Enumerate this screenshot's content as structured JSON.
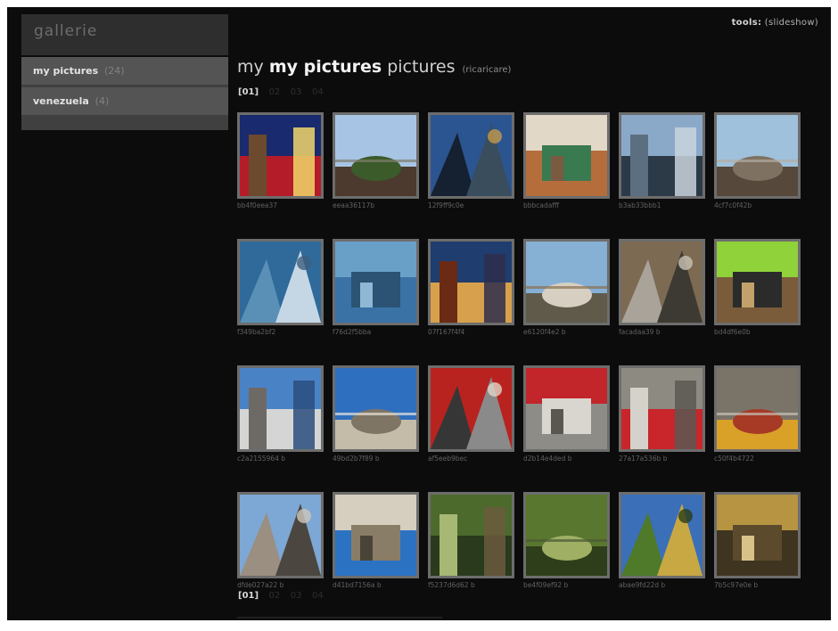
{
  "sidebar": {
    "brand": "gallerie",
    "galleries": [
      {
        "label": "my pictures",
        "count": "(24)"
      },
      {
        "label": "venezuela",
        "count": "(4)"
      }
    ]
  },
  "tools": {
    "label": "tools:",
    "slideshow": "(slideshow)"
  },
  "header": {
    "prefix": "my",
    "strong": "my pictures",
    "suffix": "pictures",
    "reload": "(ricaricare)"
  },
  "pager": {
    "current": "[01]",
    "pages": [
      "02",
      "03",
      "04"
    ]
  },
  "photos": [
    {
      "caption": "bb4f0eea37",
      "palette": [
        "#1a2a6e",
        "#b51c2a",
        "#6b4a2e",
        "#f1d66a"
      ]
    },
    {
      "caption": "eeaa36117b",
      "palette": [
        "#a8c4e4",
        "#4b3a2d",
        "#3c5b2a",
        "#7d7d6c"
      ]
    },
    {
      "caption": "12f9ff9c0e",
      "palette": [
        "#2b5590",
        "#152030",
        "#3a4d5c",
        "#c39a4c"
      ]
    },
    {
      "caption": "bbbcadafff",
      "palette": [
        "#b56d3c",
        "#e2d8c8",
        "#3a7a50",
        "#7a5a40"
      ]
    },
    {
      "caption": "b3ab33bbb1",
      "palette": [
        "#8aa9c9",
        "#2c3a48",
        "#5c6f80",
        "#c9d3dd"
      ]
    },
    {
      "caption": "4cf7c0f42b",
      "palette": [
        "#9fc1db",
        "#56483b",
        "#7f7161",
        "#b4aea4"
      ]
    },
    {
      "caption": "f349ba2bf2",
      "palette": [
        "#2f6a9a",
        "#5b90b6",
        "#c5d7e5",
        "#3d5e7d"
      ]
    },
    {
      "caption": "f76d2f5bba",
      "palette": [
        "#3a72a6",
        "#68a0c8",
        "#2c5274",
        "#8fb8d4"
      ]
    },
    {
      "caption": "07f167f4f4",
      "palette": [
        "#1f3d6e",
        "#d7a04c",
        "#6b2a14",
        "#2e2e4e"
      ]
    },
    {
      "caption": "e6120f4e2 b",
      "palette": [
        "#86b0d4",
        "#5f5a4a",
        "#d6cfc2",
        "#8a7050"
      ]
    },
    {
      "caption": "facadaa39 b",
      "palette": [
        "#7c6a52",
        "#a9a39a",
        "#3d3a33",
        "#c9c2b4"
      ]
    },
    {
      "caption": "bd4df6e0b",
      "palette": [
        "#7a5c3a",
        "#8fd23a",
        "#2b2b2b",
        "#c2a26a"
      ]
    },
    {
      "caption": "c2a2155964 b",
      "palette": [
        "#4a82c6",
        "#d5d5d5",
        "#6d6a65",
        "#2c4e7e"
      ]
    },
    {
      "caption": "49bd2b7f89 b",
      "palette": [
        "#2f6fc0",
        "#c4bba8",
        "#7f7564",
        "#e8e4dc"
      ]
    },
    {
      "caption": "af5eeb9bec",
      "palette": [
        "#b8231f",
        "#363636",
        "#8a8a8a",
        "#e0d6c8"
      ]
    },
    {
      "caption": "d2b14e4ded b",
      "palette": [
        "#8e8c86",
        "#c2252a",
        "#d8d6cf",
        "#5a5650"
      ]
    },
    {
      "caption": "27a17a536b b",
      "palette": [
        "#8d8a82",
        "#c8262a",
        "#d4d2cb",
        "#5c5852"
      ]
    },
    {
      "caption": "c50f4b4722",
      "palette": [
        "#7a7468",
        "#d9a127",
        "#a63a25",
        "#c7c2b8"
      ]
    },
    {
      "caption": "dfde027a22 b",
      "palette": [
        "#7da7d4",
        "#9a8f80",
        "#4b4640",
        "#cfc7bb"
      ]
    },
    {
      "caption": "d41bd7156a b",
      "palette": [
        "#2c72c2",
        "#d6cfc0",
        "#8a7d68",
        "#4a4438"
      ]
    },
    {
      "caption": "f5237d6d62 b",
      "palette": [
        "#4c6a2c",
        "#2a3a1c",
        "#a7b875",
        "#6b5a3e"
      ]
    },
    {
      "caption": "be4f09ef92 b",
      "palette": [
        "#59772e",
        "#2e3e1a",
        "#9fb064",
        "#4b5a36"
      ]
    },
    {
      "caption": "abae9fd22d b",
      "palette": [
        "#3b6fb8",
        "#4e7a2a",
        "#c8a843",
        "#2c3d18"
      ]
    },
    {
      "caption": "7b5c97e0e b",
      "palette": [
        "#3e3420",
        "#b69442",
        "#5c4a2c",
        "#d8c28a"
      ]
    }
  ],
  "footer": {
    "pager": "[01]"
  }
}
